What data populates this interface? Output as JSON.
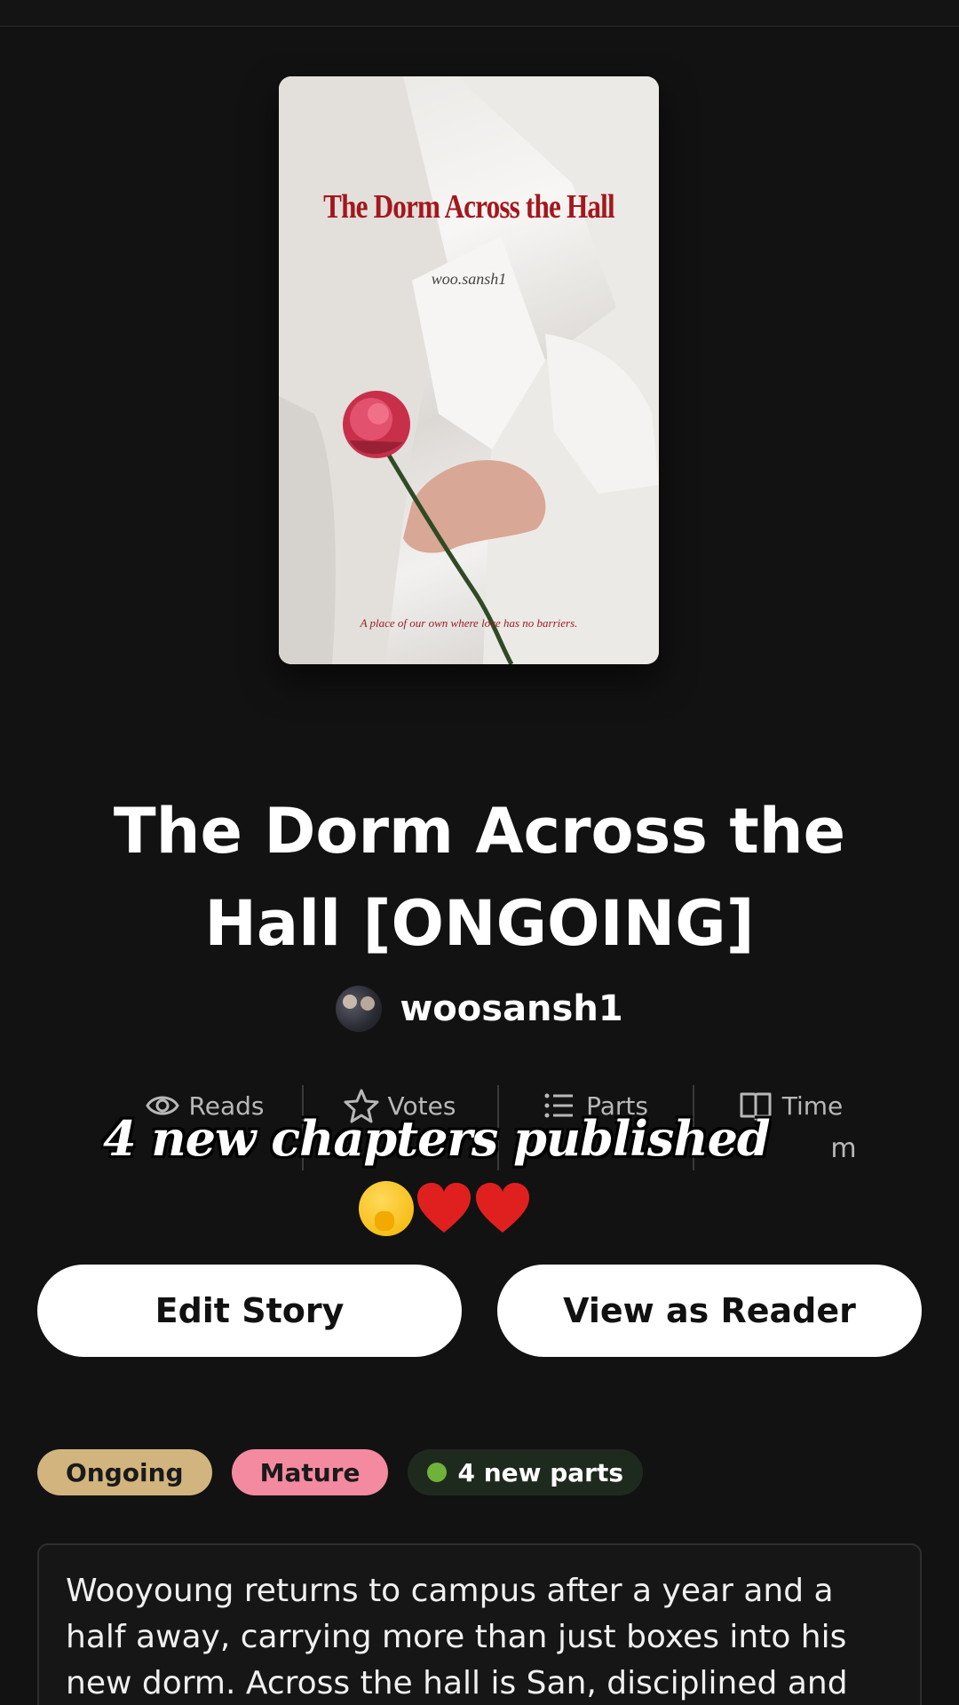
{
  "cover": {
    "title": "The Dorm Across the Hall",
    "author": "woo.sansh1",
    "tagline": "A place of our own where love has no barriers."
  },
  "story": {
    "title": "The Dorm Across the Hall [ONGOING]",
    "author": "woosansh1"
  },
  "stats": [
    {
      "label": "Reads",
      "icon": "eye-icon"
    },
    {
      "label": "Votes",
      "icon": "star-icon"
    },
    {
      "label": "Parts",
      "icon": "list-icon"
    },
    {
      "label": "Time",
      "icon": "book-icon",
      "value_partial": "m"
    }
  ],
  "overlay": {
    "text": "4 new chapters published",
    "emoji": [
      "shushing-face",
      "red-heart",
      "red-heart"
    ]
  },
  "buttons": {
    "edit": "Edit Story",
    "view": "View as Reader"
  },
  "tags": {
    "ongoing": "Ongoing",
    "mature": "Mature",
    "new_parts": "4 new parts"
  },
  "description": "Wooyoung returns to campus after a year and a half away, carrying more than just boxes into his new dorm. Across the hall is San, disciplined and guarded.",
  "colors": {
    "background": "#121212",
    "tag_ongoing": "#d2b47e",
    "tag_mature": "#f48aa0",
    "new_dot": "#6fb23a",
    "cover_title": "#a3171d"
  }
}
